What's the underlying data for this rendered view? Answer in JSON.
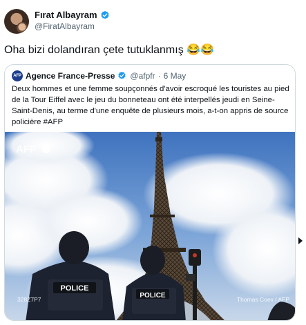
{
  "tweet": {
    "author": {
      "name": "Fırat Albayram",
      "handle": "@FiratAlbayram",
      "verified": true
    },
    "text": "Oha bizi dolandıran çete tutuklanmış 😂😂",
    "quoted": {
      "author": {
        "name": "Agence France-Presse",
        "handle": "@afpfr",
        "avatar_text": "AFP",
        "verified": true
      },
      "separator": "·",
      "date": "6 May",
      "text": "Deux hommes et une femme soupçonnés d'avoir escroqué les touristes au pied de la Tour Eiffel avec le jeu du bonneteau ont été interpellés jeudi en Seine-Saint-Denis, au terme d'une enquête de plusieurs mois, a-t-on appris de source policière #AFP",
      "media": {
        "watermark": "AFP",
        "photo_id": "328Z7P7",
        "credit": "Thomas Coex / AFP",
        "police_label_1": "POLICE",
        "police_label_2": "POLICE"
      }
    }
  },
  "colors": {
    "verified": "#1d9bf0",
    "secondary_text": "#536471",
    "border": "#cfd9de",
    "afp_blue": "#1e3d8c"
  }
}
